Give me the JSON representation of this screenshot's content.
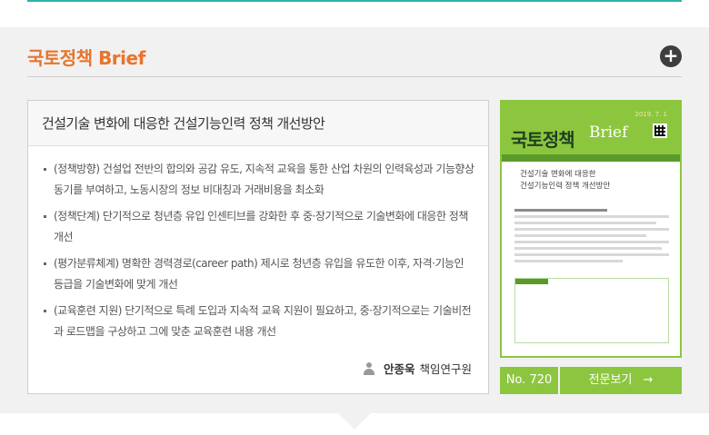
{
  "section": {
    "title": "국토정책 Brief",
    "more_icon": "plus-circle-icon"
  },
  "article": {
    "title": "건설기술 변화에 대응한 건설기능인력 정책 개선방안",
    "bullets": [
      "(정책방향) 건설업 전반의 합의와 공감 유도, 지속적 교육을 통한 산업 차원의 인력육성과 기능향상 동기를 부여하고, 노동시장의 정보 비대칭과 거래비용을 최소화",
      "(정책단계) 단기적으로 청년층 유입 인센티브를 강화한 후 중·장기적으로 기술변화에 대응한 정책 개선",
      "(평가분류체계) 명확한 경력경로(career path) 제시로 청년층 유입을 유도한 이후, 자격·기능인 등급을 기술변화에 맞게 개선",
      "(교육훈련 지원) 단기적으로 특례 도입과 지속적 교육 지원이 필요하고, 중·장기적으로는 기술비전과 로드맵을 구상하고 그에 맞춘 교육훈련 내용 개선"
    ],
    "author_icon": "person-icon",
    "author_name": "안종욱",
    "author_role": "책임연구원"
  },
  "cover": {
    "title_k": "국토정책",
    "title_e": "Brief",
    "issue": "2019. 7. 1",
    "subtitle_1": "건설기술 변화에 대응한",
    "subtitle_2": "건설기능인력 정책 개선방안"
  },
  "footer": {
    "issue_no": "No. 720",
    "view_label": "전문보기",
    "view_icon": "arrow-right-icon"
  },
  "colors": {
    "accent_orange": "#e8742c",
    "accent_green": "#8cc63f",
    "teal_line": "#2bb3a8"
  }
}
